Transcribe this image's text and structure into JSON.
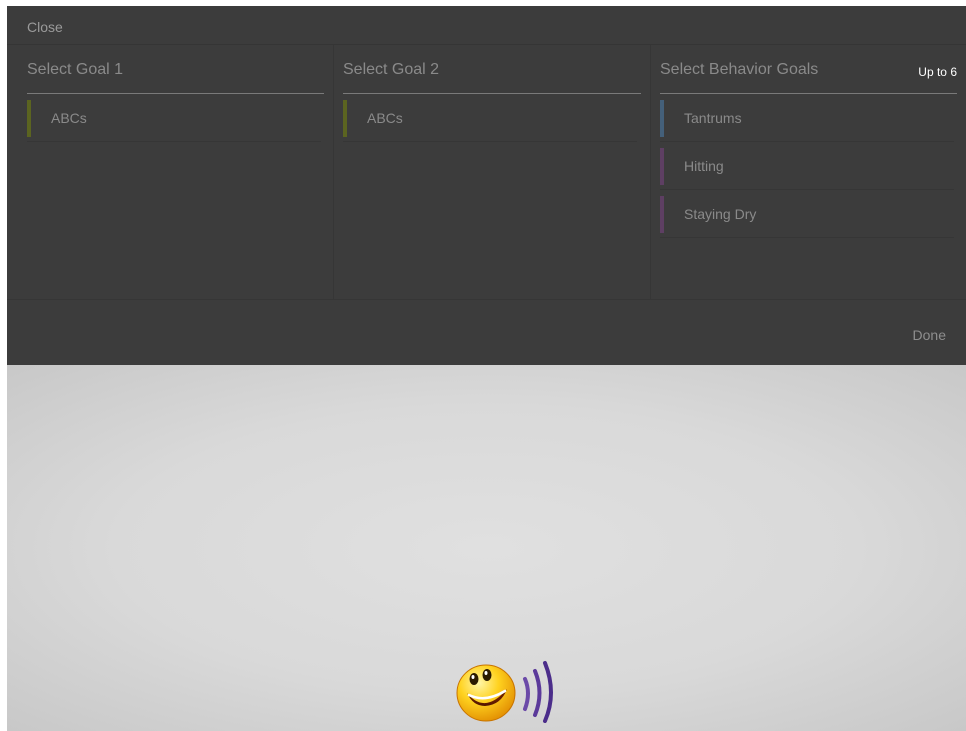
{
  "header": {
    "close_label": "Close"
  },
  "columns": [
    {
      "title": "Select Goal 1",
      "limit": "",
      "items": [
        {
          "label": "ABCs",
          "color": "#5b6420"
        }
      ]
    },
    {
      "title": "Select Goal 2",
      "limit": "",
      "items": [
        {
          "label": "ABCs",
          "color": "#5b6420"
        }
      ]
    },
    {
      "title": "Select Behavior Goals",
      "limit": "Up to 6",
      "items": [
        {
          "label": "Tantrums",
          "color": "#44607a"
        },
        {
          "label": "Hitting",
          "color": "#5e3f63"
        },
        {
          "label": "Staying Dry",
          "color": "#5e3f63"
        }
      ]
    }
  ],
  "footer": {
    "done_label": "Done"
  },
  "mascot": {
    "icon": "smiley-speaker-icon"
  }
}
